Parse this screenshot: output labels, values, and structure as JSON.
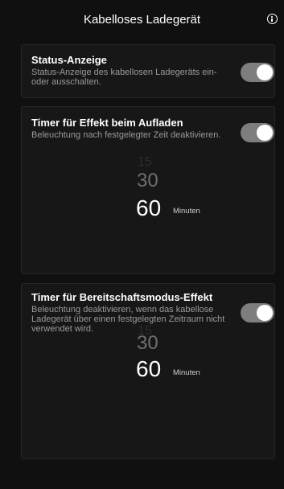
{
  "header": {
    "title": "Kabelloses Ladegerät",
    "info_icon": "info-icon"
  },
  "cards": [
    {
      "title": "Status-Anzeige",
      "description": "Status-Anzeige des kabellosen Ladegeräts ein- oder ausschalten.",
      "toggle_on": true
    },
    {
      "title": "Timer für Effekt beim Aufladen",
      "description": "Beleuchtung nach festgelegter Zeit deaktivieren.",
      "toggle_on": true,
      "picker": {
        "faint_value": "15",
        "mid_value": "30",
        "selected_value": "60",
        "unit": "Minuten"
      }
    },
    {
      "title": "Timer für Bereitschaftsmodus-Effekt",
      "description": "Beleuchtung deaktivieren, wenn das kabellose Ladegerät über einen festgelegten Zeitraum nicht verwendet wird.",
      "toggle_on": true,
      "picker": {
        "faint_value": "15",
        "mid_value": "30",
        "selected_value": "60",
        "unit": "Minuten"
      }
    }
  ],
  "colors": {
    "background": "#101010",
    "card": "#171717",
    "toggle_track": "#7e7e7e",
    "description_text": "#9a9a9a"
  }
}
